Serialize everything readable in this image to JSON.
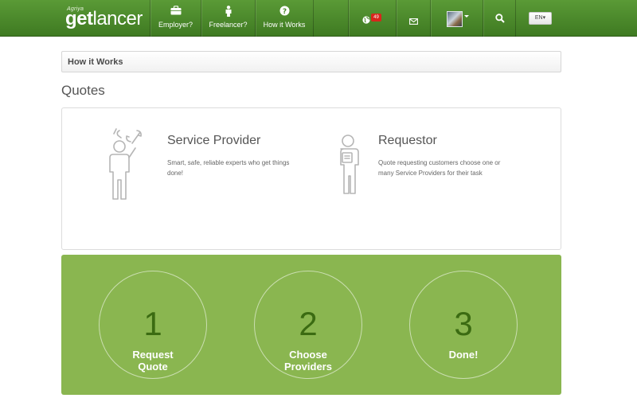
{
  "brand": {
    "small": "Agriya",
    "get": "get",
    "lancer": "lancer"
  },
  "nav": {
    "items": [
      {
        "label": "Employer?",
        "icon": "briefcase-icon"
      },
      {
        "label": "Freelancer?",
        "icon": "person-icon"
      },
      {
        "label": "How it Works",
        "icon": "question-circle-icon"
      }
    ],
    "notification_count": "49",
    "language": "EN"
  },
  "breadcrumb": "How it Works",
  "page_title": "Quotes",
  "roles": [
    {
      "title": "Service Provider",
      "description": "Smart, safe, reliable experts who get things done!"
    },
    {
      "title": "Requestor",
      "description": "Quote requesting customers choose one or many Service Providers for their task"
    }
  ],
  "steps": [
    {
      "number": "1",
      "label_line1": "Request",
      "label_line2": "Quote"
    },
    {
      "number": "2",
      "label_line1": "Choose",
      "label_line2": "Providers"
    },
    {
      "number": "3",
      "label_line1": "Done!",
      "label_line2": ""
    }
  ],
  "colors": {
    "nav_green": "#4a8a2b",
    "steps_green": "#8ab650",
    "step_number": "#3b6b12",
    "badge_red": "#d9261c"
  }
}
